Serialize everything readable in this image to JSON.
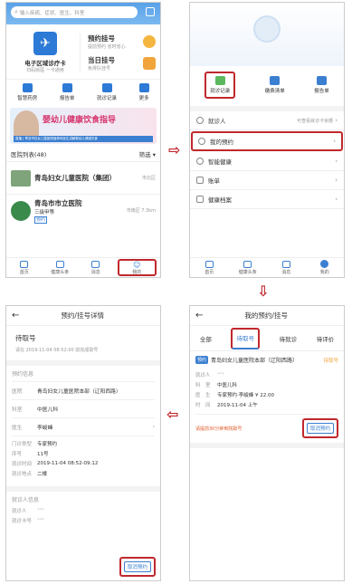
{
  "home": {
    "search_placeholder": "输入疾病、症状、医生、科室",
    "card_title": "电子区域诊疗卡",
    "card_sub": "扫码就医 一卡通用",
    "appt_label": "预约挂号",
    "appt_sub": "提前预约 省时省心",
    "today_label": "当日挂号",
    "today_sub": "免排队挂号",
    "grid": [
      "智慧药房",
      "报告单",
      "就诊记录",
      "更多"
    ],
    "banner_title": "婴幼儿健康饮食指导",
    "banner_sub": "直播 | 青岛市妇女儿童医院营养科医生讲解婴幼儿健康饮食",
    "hospital_list_label": "医院列表(48)",
    "filter_label": "筛选",
    "hospitals": [
      {
        "name": "青岛妇女儿童医院（集团）",
        "district": "市北区"
      },
      {
        "name": "青岛市市立医院",
        "level": "三级甲等",
        "tag": "预约",
        "district": "市南区 7.3km"
      }
    ],
    "tabs": [
      "首页",
      "健康头条",
      "消息",
      "我的"
    ]
  },
  "mine": {
    "quick": [
      "就诊记录",
      "缴费清单",
      "报告单"
    ],
    "menu": [
      {
        "label": "就诊人",
        "value": "可查看就诊卡余额"
      },
      {
        "label": "我的预约"
      },
      {
        "label": "智能健康"
      },
      {
        "label": "账单"
      },
      {
        "label": "健康档案"
      }
    ],
    "tabs": [
      "首页",
      "健康头条",
      "消息",
      "我的"
    ]
  },
  "appt_list": {
    "title": "我的预约/挂号",
    "tabs": [
      "全部",
      "待取号",
      "待就诊",
      "待评价"
    ],
    "badge": "预约",
    "hospital": "青岛妇女儿童医院本部（辽阳西路）",
    "status": "待取号",
    "fields": [
      {
        "k": "就诊人",
        "v": "***"
      },
      {
        "k": "科　室",
        "v": "中医儿科"
      },
      {
        "k": "医　生",
        "v": "专家预约·李峻峰 ¥ 22.00"
      },
      {
        "k": "时　间",
        "v": "2019-11-04 上午"
      }
    ],
    "notice": "请提前30分钟到院取号",
    "cancel": "取消预约"
  },
  "detail": {
    "title": "预约/挂号详情",
    "status": "待取号",
    "status_time": "请在 2019-11-04 08:52:00 前完成取号",
    "section_appt": "预约信息",
    "rows": [
      {
        "k": "医院",
        "v": "青岛妇女儿童医院本部（辽阳西路）"
      },
      {
        "k": "科室",
        "v": "中医儿科"
      },
      {
        "k": "医生",
        "v": "李峻峰"
      }
    ],
    "rows2": [
      {
        "k": "门诊类型",
        "v": "专家预约"
      },
      {
        "k": "序号",
        "v": "11号"
      },
      {
        "k": "就诊时间",
        "v": "2019-11-04 08:52-09:12"
      },
      {
        "k": "就诊地点",
        "v": "二楼"
      }
    ],
    "section_patient": "就诊人信息",
    "patient_rows": [
      {
        "k": "就诊人",
        "v": "***"
      },
      {
        "k": "就诊卡号",
        "v": "***"
      }
    ],
    "cancel": "取消预约"
  }
}
